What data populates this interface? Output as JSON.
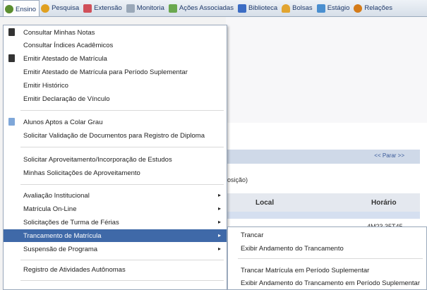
{
  "menubar": {
    "items": [
      {
        "label": "Ensino",
        "color": "#5b8e2f"
      },
      {
        "label": "Pesquisa",
        "color": "#e0a020"
      },
      {
        "label": "Extensão",
        "color": "#d0505a"
      },
      {
        "label": "Monitoria",
        "color": "#9aa8b8"
      },
      {
        "label": "Ações Associadas",
        "color": "#6aa84f"
      },
      {
        "label": "Biblioteca",
        "color": "#3b6cc4"
      },
      {
        "label": "Bolsas",
        "color": "#e2a531"
      },
      {
        "label": "Estágio",
        "color": "#4a8fd0"
      },
      {
        "label": "Relações",
        "color": "#d47b19"
      }
    ]
  },
  "dropdown": {
    "items": [
      {
        "label": "Consultar Minhas Notas",
        "icon": "document-icon"
      },
      {
        "label": "Consultar Índices Acadêmicos"
      },
      {
        "label": "Emitir Atestado de Matrícula",
        "icon": "document-icon"
      },
      {
        "label": "Emitir Atestado de Matrícula para Período Suplementar"
      },
      {
        "label": "Emitir Histórico"
      },
      {
        "label": "Emitir Declaração de Vínculo"
      },
      {
        "label": "Alunos Aptos a Colar Grau",
        "icon": "certificate-icon"
      },
      {
        "label": "Solicitar Validação de Documentos para Registro de Diploma"
      },
      {
        "label": "Solicitar Aproveitamento/Incorporação de Estudos"
      },
      {
        "label": "Minhas Solicitações de Aproveitamento"
      },
      {
        "label": "Avaliação Institucional"
      },
      {
        "label": "Matrícula On-Line"
      },
      {
        "label": "Solicitações de Turma de Férias"
      },
      {
        "label": "Trancamento de Matrícula"
      },
      {
        "label": "Suspensão de Programa"
      },
      {
        "label": "Registro de Atividades Autônomas"
      }
    ]
  },
  "submenu": {
    "items": [
      {
        "label": "Trancar"
      },
      {
        "label": "Exibir Andamento do Trancamento"
      },
      {
        "label": "Trancar Matrícula em Período Suplementar"
      },
      {
        "label": "Exibir Andamento do Trancamento em Período Suplementar"
      }
    ]
  },
  "background": {
    "parar_link": "<< Parar >>",
    "posicao_text": "osição)",
    "th_local": "Local",
    "th_horario": "Horário",
    "cell_horario": "4M23 35T45"
  },
  "colors": {
    "highlight": "#3f69a8",
    "menubar_text": "#1f3a6b"
  }
}
